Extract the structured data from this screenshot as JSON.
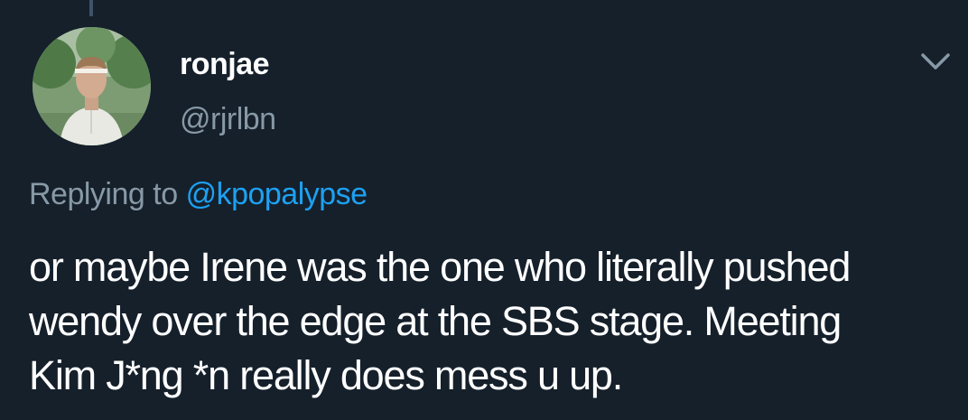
{
  "user": {
    "display_name": "ronjae",
    "handle": "@rjrlbn"
  },
  "reply": {
    "prefix": "Replying to",
    "target": "@kpopalypse"
  },
  "tweet": {
    "lines": [
      "or maybe Irene was the one who literally pushed",
      "wendy over the edge at the SBS stage. Meeting",
      "Kim J*ng *n really does mess u up."
    ]
  },
  "icons": {
    "menu": "chevron-down-icon",
    "avatar": "profile-photo"
  },
  "colors": {
    "background": "#15202b",
    "text": "#ffffff",
    "secondary": "#8899a6",
    "link": "#1da1f2"
  }
}
